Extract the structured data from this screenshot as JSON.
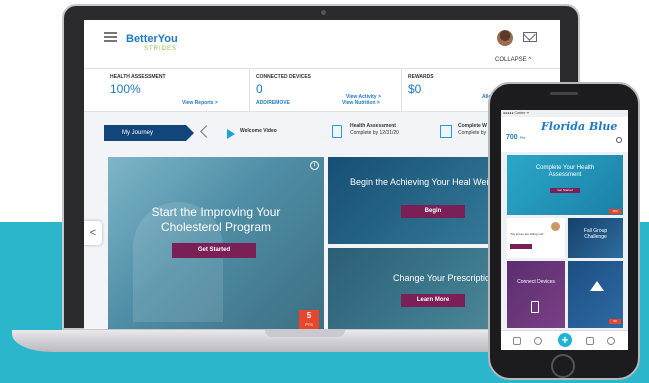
{
  "laptop": {
    "header": {
      "logo_main": "BetterYou",
      "logo_sub": "STRIDES",
      "collapse_label": "COLLAPSE ^"
    },
    "stats": {
      "health_assessment": {
        "title": "HEALTH ASSESSMENT",
        "value": "100%",
        "link": "View Reports >"
      },
      "connected_devices": {
        "title": "CONNECTED DEVICES",
        "value": "0",
        "link_add": "ADD/REMOVE",
        "link_activity": "View Activity >",
        "link_nutrition": "View Nutrition >"
      },
      "rewards": {
        "title": "REWARDS",
        "value": "$0",
        "link": "Allo"
      }
    },
    "journey": {
      "button": "My Journey",
      "steps": [
        {
          "title": "Welcome Video",
          "sub": ""
        },
        {
          "title": "Health Assessment",
          "sub": "Complete by 12/31/20"
        },
        {
          "title": "Complete W",
          "sub": "Complete by"
        }
      ]
    },
    "cards": {
      "main": {
        "title": "Start the Improving Your Cholesterol Program",
        "button": "Get Started",
        "points": "5",
        "points_unit": "PTS"
      },
      "right_top": {
        "title": "Begin the Achieving Your Heal Weight Program",
        "button": "Begin"
      },
      "right_bottom": {
        "title": "Change Your Prescription",
        "button": "Learn More"
      }
    },
    "nav_arrow": "<"
  },
  "phone": {
    "status": "●●●●● Carrier ᯤ",
    "points": "700",
    "points_unit": "Pts",
    "brand": "Florida Blue",
    "hero": {
      "title": "Complete Your Health Assessment",
      "button": "Get Started",
      "points": "100"
    },
    "note": {
      "text": "\"My stress are killing me!\""
    },
    "pump": {
      "title": "Fall Group Challenge"
    },
    "dl": {
      "title": "Connect Devices"
    },
    "fb": {
      "points": "50"
    }
  },
  "colors": {
    "brand_blue": "#1f7ac2",
    "navy": "#12457a",
    "plum": "#7b1f57",
    "teal": "#2bb6cc",
    "badge_red": "#e8462c"
  }
}
